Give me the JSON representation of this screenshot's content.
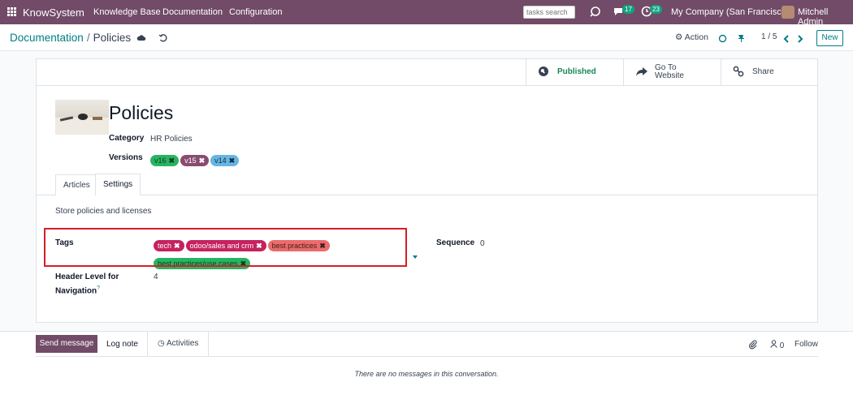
{
  "navbar": {
    "brand": "KnowSystem",
    "menu": [
      "Knowledge Base",
      "Documentation",
      "Configuration"
    ],
    "search_placeholder": "tasks search",
    "messages_count": "17",
    "activities_count": "23",
    "company": "My Company (San Francisco)",
    "user": "Mitchell Admin"
  },
  "control_panel": {
    "breadcrumb_parent": "Documentation",
    "breadcrumb_sep": "/",
    "breadcrumb_current": "Policies",
    "action_label": "Action",
    "pager": "1 / 5",
    "new_label": "New"
  },
  "smart_buttons": {
    "published": "Published",
    "go_to_line1": "Go To",
    "go_to_line2": "Website",
    "share": "Share"
  },
  "record": {
    "title": "Policies",
    "category_label": "Category",
    "category_value": "HR Policies",
    "versions_label": "Versions",
    "versions": [
      {
        "label": "v16",
        "color": "#28b463"
      },
      {
        "label": "v15",
        "color": "#8a4b71"
      },
      {
        "label": "v14",
        "color": "#67b5e2"
      }
    ]
  },
  "tabs": [
    "Articles",
    "Settings"
  ],
  "settings": {
    "description": "Store policies and licenses",
    "tags_label": "Tags",
    "tags": [
      {
        "label": "tech",
        "color": "#c5225f"
      },
      {
        "label": "odoo/sales and crm",
        "color": "#c5225f"
      },
      {
        "label": "best practices",
        "color": "#ec6b6b",
        "text_color": "#3b1d1d"
      },
      {
        "label": "best practices/use cases",
        "color": "#28b463",
        "text_color": "#0b3d1f"
      }
    ],
    "sequence_label": "Sequence",
    "sequence_value": "0",
    "header_level_label_line1": "Header Level for",
    "header_level_label_line2": "Navigation",
    "header_level_help": "?",
    "header_level_value": "4"
  },
  "chatter": {
    "send_message": "Send message",
    "log_note": "Log note",
    "activities": "Activities",
    "followers_count": "0",
    "follow": "Follow",
    "no_messages": "There are no messages in this conversation."
  },
  "colors": {
    "brand": "#714b67",
    "accent": "#017e84",
    "highlight": "#d32027"
  }
}
